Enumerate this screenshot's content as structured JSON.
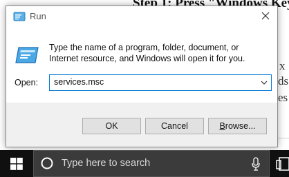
{
  "background": {
    "heading": "Step 1: Press \"Windows Key",
    "fragments": [
      "x",
      "ds",
      "es"
    ]
  },
  "dialog": {
    "title": "Run",
    "description": "Type the name of a program, folder, document, or Internet resource, and Windows will open it for you.",
    "open_label": "Open:",
    "open_value": "services.msc",
    "buttons": {
      "ok": "OK",
      "cancel": "Cancel",
      "browse_prefix": "",
      "browse_underlined": "B",
      "browse_rest": "rowse..."
    },
    "icons": {
      "title": "run-icon",
      "main": "run-icon",
      "close": "close-icon",
      "dropdown": "chevron-down-icon"
    }
  },
  "taskbar": {
    "search_placeholder": "Type here to search",
    "icons": [
      "windows-logo-icon",
      "search-icon",
      "microphone-icon",
      "task-view-icon"
    ]
  },
  "colors": {
    "accent": "#0078d7",
    "taskbar": "#101010",
    "search_box": "#3b3b3b",
    "button_face": "#e1e1e1"
  }
}
